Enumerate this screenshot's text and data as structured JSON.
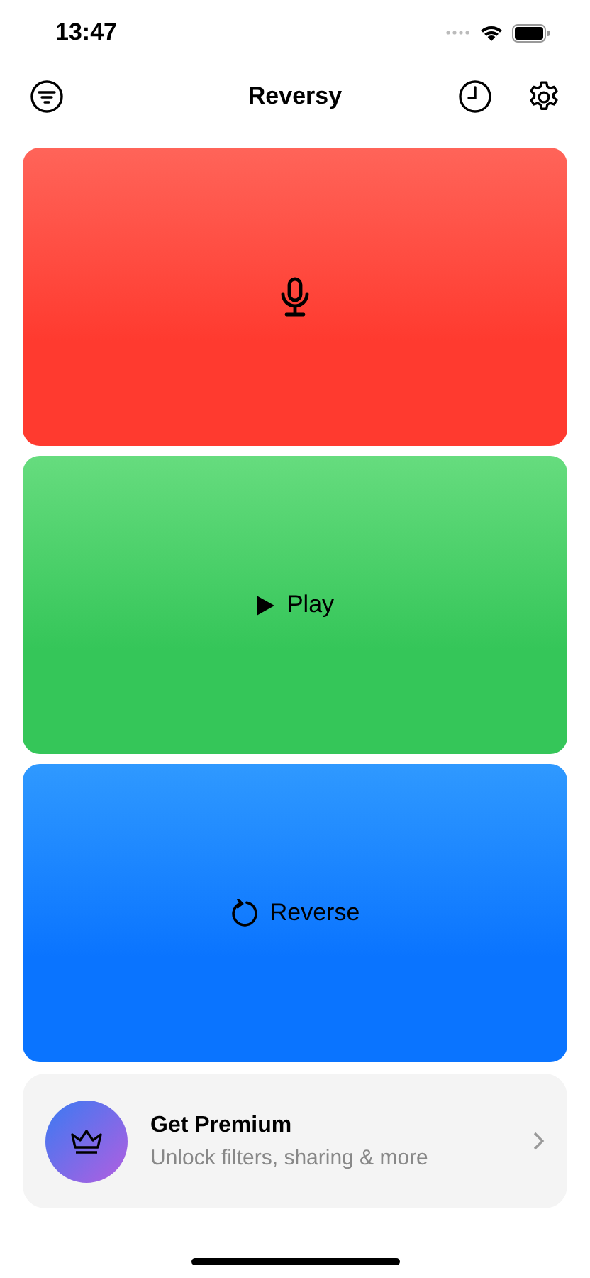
{
  "status_bar": {
    "time": "13:47"
  },
  "nav": {
    "title": "Reversy"
  },
  "panels": [
    {
      "kind": "record"
    },
    {
      "kind": "play",
      "label": "Play"
    },
    {
      "kind": "reverse",
      "label": "Reverse"
    }
  ],
  "premium": {
    "title": "Get Premium",
    "subtitle": "Unlock filters, sharing & more"
  }
}
